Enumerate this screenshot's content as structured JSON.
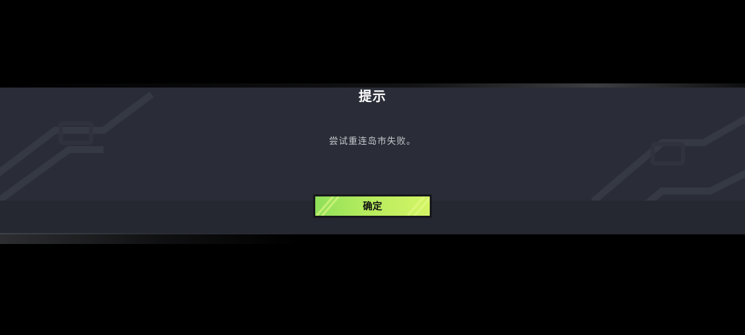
{
  "dialog": {
    "title": "提示",
    "message": "尝试重连岛市失败。",
    "confirm_label": "确定"
  },
  "colors": {
    "background": "#000000",
    "panel": "#2a2d37",
    "panel_footer": "#252831",
    "accent_green": "#b6ec5e",
    "title_text": "#ffffff",
    "message_text": "#c4c6cc"
  }
}
